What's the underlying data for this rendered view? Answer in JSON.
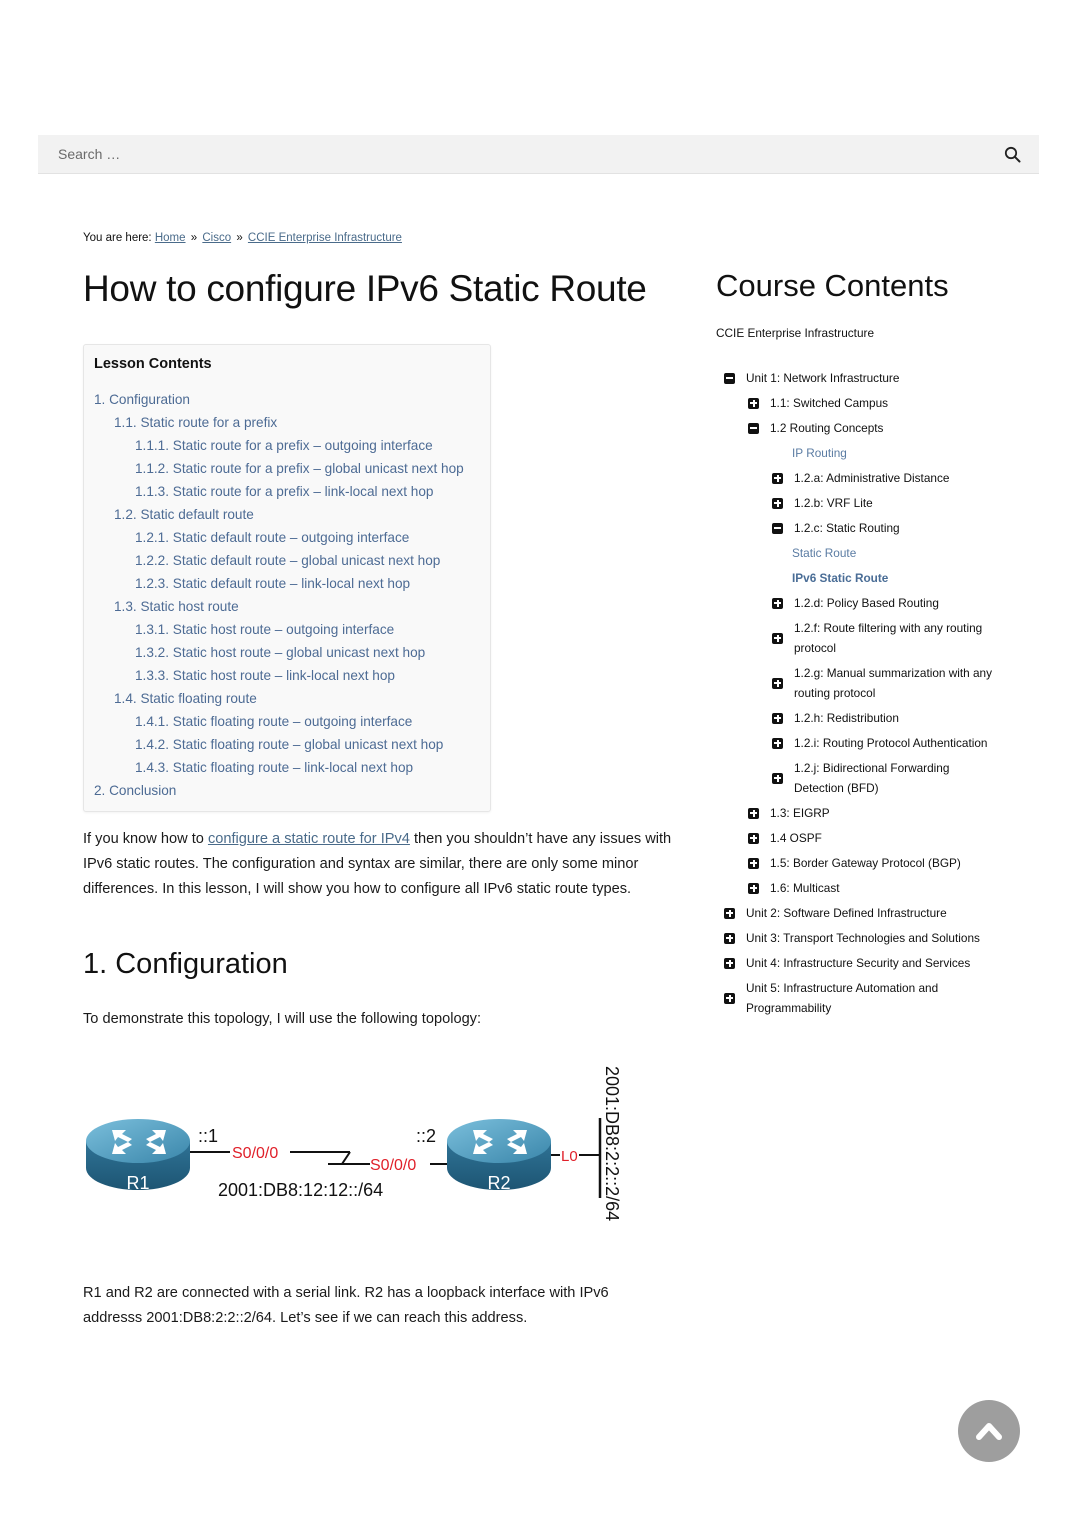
{
  "search": {
    "placeholder": "Search …"
  },
  "breadcrumb": {
    "prefix": "You are here:",
    "separator": "»",
    "items": [
      "Home",
      "Cisco",
      "CCIE Enterprise Infrastructure"
    ]
  },
  "page": {
    "title": "How to configure IPv6 Static Route"
  },
  "lesson_contents": {
    "title": "Lesson Contents",
    "items": [
      {
        "level": 1,
        "label": "1. Configuration"
      },
      {
        "level": 2,
        "label": "1.1. Static route for a prefix"
      },
      {
        "level": 3,
        "label": "1.1.1. Static route for a prefix – outgoing interface"
      },
      {
        "level": 3,
        "label": "1.1.2. Static route for a prefix – global unicast next hop"
      },
      {
        "level": 3,
        "label": "1.1.3. Static route for a prefix – link-local next hop"
      },
      {
        "level": 2,
        "label": "1.2. Static default route"
      },
      {
        "level": 3,
        "label": "1.2.1. Static default route – outgoing interface"
      },
      {
        "level": 3,
        "label": "1.2.2. Static default route – global unicast next hop"
      },
      {
        "level": 3,
        "label": "1.2.3. Static default route – link-local next hop"
      },
      {
        "level": 2,
        "label": "1.3. Static host route"
      },
      {
        "level": 3,
        "label": "1.3.1. Static host route – outgoing interface"
      },
      {
        "level": 3,
        "label": "1.3.2. Static host route – global unicast next hop"
      },
      {
        "level": 3,
        "label": "1.3.3. Static host route – link-local next hop"
      },
      {
        "level": 2,
        "label": "1.4. Static floating route"
      },
      {
        "level": 3,
        "label": "1.4.1. Static floating route – outgoing interface"
      },
      {
        "level": 3,
        "label": "1.4.2. Static floating route – global unicast next hop"
      },
      {
        "level": 3,
        "label": "1.4.3. Static floating route – link-local next hop"
      },
      {
        "level": 1,
        "label": "2. Conclusion"
      }
    ]
  },
  "intro": {
    "before_link": "If you know how to ",
    "link": "configure a static route for IPv4",
    "after_link": " then you shouldn’t have any issues with IPv6 static routes. The configuration and syntax are similar, there are only some minor differences. In this lesson, I will show you how to configure all IPv6 static route types."
  },
  "section1": {
    "heading": "1. Configuration",
    "demo_text": "To demonstrate this topology, I will use the following topology:"
  },
  "topology": {
    "r1_label": "R1",
    "r2_label": "R2",
    "r1_addr": "::1",
    "r2_addr": "::2",
    "r1_iface": "S0/0/0",
    "r2_iface": "S0/0/0",
    "link_subnet": "2001:DB8:12:12::/64",
    "loopback_iface": "L0",
    "loopback_subnet": "2001:DB8:2:2::2/64",
    "router_color": "#3a82a6",
    "iface_color": "#e0202a"
  },
  "outro": {
    "text": "R1 and R2 are connected with a serial link. R2 has a loopback interface with IPv6 addresss 2001:DB8:2:2::2/64. Let’s see if we can reach this address."
  },
  "sidebar": {
    "title": "Course Contents",
    "course": "CCIE Enterprise Infrastructure",
    "tree": [
      {
        "label": "Unit 1: Network Infrastructure",
        "level": 0,
        "state": "expanded"
      },
      {
        "label": "1.1: Switched Campus",
        "level": 1,
        "state": "collapsed"
      },
      {
        "label": "1.2 Routing Concepts",
        "level": 1,
        "state": "expanded"
      },
      {
        "label": "IP Routing",
        "level": 2,
        "state": "leaf"
      },
      {
        "label": "1.2.a: Administrative Distance",
        "level": 2,
        "state": "collapsed"
      },
      {
        "label": "1.2.b: VRF Lite",
        "level": 2,
        "state": "collapsed"
      },
      {
        "label": "1.2.c: Static Routing",
        "level": 2,
        "state": "expanded"
      },
      {
        "label": "Static Route",
        "level": 3,
        "state": "leaf"
      },
      {
        "label": "IPv6 Static Route",
        "level": 3,
        "state": "current"
      },
      {
        "label": "1.2.d: Policy Based Routing",
        "level": 2,
        "state": "collapsed"
      },
      {
        "label": "1.2.f: Route filtering with any routing protocol",
        "level": 2,
        "state": "collapsed"
      },
      {
        "label": "1.2.g: Manual summarization with any routing protocol",
        "level": 2,
        "state": "collapsed"
      },
      {
        "label": "1.2.h: Redistribution",
        "level": 2,
        "state": "collapsed"
      },
      {
        "label": "1.2.i: Routing Protocol Authentication",
        "level": 2,
        "state": "collapsed"
      },
      {
        "label": "1.2.j: Bidirectional Forwarding Detection (BFD)",
        "level": 2,
        "state": "collapsed"
      },
      {
        "label": "1.3: EIGRP",
        "level": 1,
        "state": "collapsed"
      },
      {
        "label": "1.4 OSPF",
        "level": 1,
        "state": "collapsed"
      },
      {
        "label": "1.5: Border Gateway Protocol (BGP)",
        "level": 1,
        "state": "collapsed"
      },
      {
        "label": "1.6: Multicast",
        "level": 1,
        "state": "collapsed"
      },
      {
        "label": "Unit 2: Software Defined Infrastructure",
        "level": 0,
        "state": "collapsed"
      },
      {
        "label": "Unit 3: Transport Technologies and Solutions",
        "level": 0,
        "state": "collapsed"
      },
      {
        "label": "Unit 4: Infrastructure Security and Services",
        "level": 0,
        "state": "collapsed"
      },
      {
        "label": "Unit 5: Infrastructure Automation and Programmability",
        "level": 0,
        "state": "collapsed"
      }
    ]
  },
  "back_to_top": {
    "icon": "chevron-up-icon"
  }
}
